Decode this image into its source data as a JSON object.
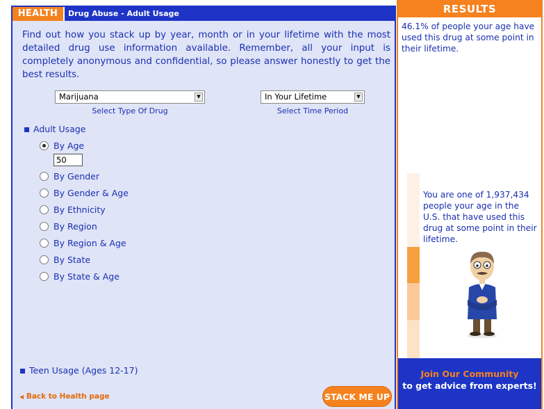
{
  "header": {
    "tag": "HEALTH",
    "title": "Drug Abuse - Adult Usage"
  },
  "intro": "Find out how you stack up by year, month or in your lifetime with the most detailed drug use information available. Remember, all your input is completely anonymous and confidential, so please answer honestly to get the best results.",
  "drug_select": {
    "value": "Marijuana",
    "label": "Select Type Of Drug"
  },
  "period_select": {
    "value": "In Your Lifetime",
    "label": "Select Time Period"
  },
  "adult_section": {
    "title": "Adult Usage",
    "options": [
      {
        "label": "By Age",
        "selected": true
      },
      {
        "label": "By Gender",
        "selected": false
      },
      {
        "label": "By Gender & Age",
        "selected": false
      },
      {
        "label": "By Ethnicity",
        "selected": false
      },
      {
        "label": "By Region",
        "selected": false
      },
      {
        "label": "By Region & Age",
        "selected": false
      },
      {
        "label": "By State",
        "selected": false
      },
      {
        "label": "By State & Age",
        "selected": false
      }
    ],
    "age_value": "50"
  },
  "teen_section": {
    "title": "Teen Usage (Ages 12-17)"
  },
  "back_link": "Back to Health page",
  "stack_button": "STACK ME UP",
  "results": {
    "title": "RESULTS",
    "text1": "46.1% of people your age have used this drug at some point in their lifetime.",
    "text2": "You are one of 1,937,434 people your age in the U.S. that have used this drug at some point in their lifetime.",
    "join_line1": "Join Our Community",
    "join_line2": "to get advice from experts!"
  },
  "colors": {
    "accent_orange": "#f5821f",
    "brand_blue": "#1d34c6",
    "panel_bg": "#dfe4f7"
  },
  "icons": {
    "back": "triangle-left-icon",
    "section": "square-bullet-icon",
    "select": "dropdown-arrow-icon"
  }
}
